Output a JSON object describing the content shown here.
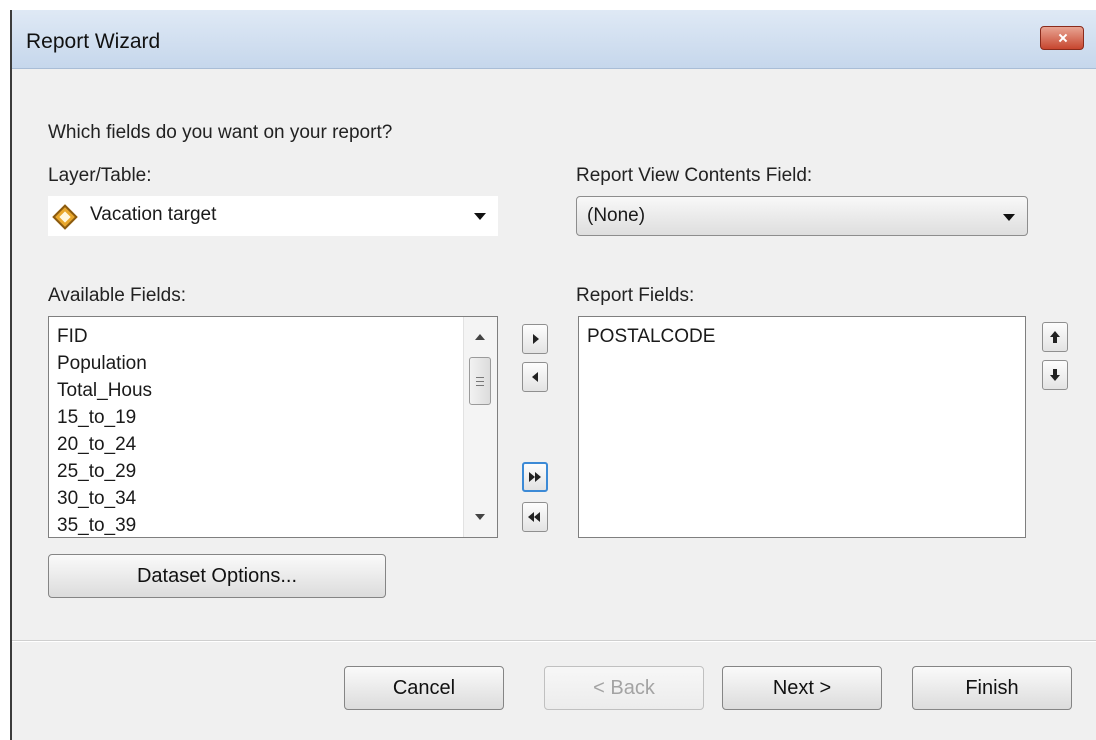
{
  "window": {
    "title": "Report Wizard"
  },
  "prompt": "Which fields do you want on your report?",
  "layer_table": {
    "label": "Layer/Table:",
    "value": "Vacation target",
    "icon": "layer-diamond-icon"
  },
  "report_view": {
    "label": "Report View Contents Field:",
    "value": "(None)"
  },
  "available_fields": {
    "label": "Available Fields:",
    "items": [
      "FID",
      "Population",
      "Total_Hous",
      "15_to_19",
      "20_to_24",
      "25_to_29",
      "30_to_34",
      "35_to_39"
    ]
  },
  "report_fields": {
    "label": "Report Fields:",
    "items": [
      "POSTALCODE"
    ]
  },
  "transfer_buttons": [
    "add-field",
    "remove-field",
    "add-all-fields",
    "remove-all-fields"
  ],
  "order_buttons": [
    "move-up",
    "move-down"
  ],
  "dataset_options": "Dataset Options...",
  "footer": {
    "cancel": "Cancel",
    "back": "< Back",
    "next": "Next >",
    "finish": "Finish"
  },
  "colors": {
    "title_bar": "#c6d7ec",
    "close_button": "#c7462f",
    "focus_border": "#3c8ad6",
    "dialog_bg": "#f0f0f0"
  }
}
